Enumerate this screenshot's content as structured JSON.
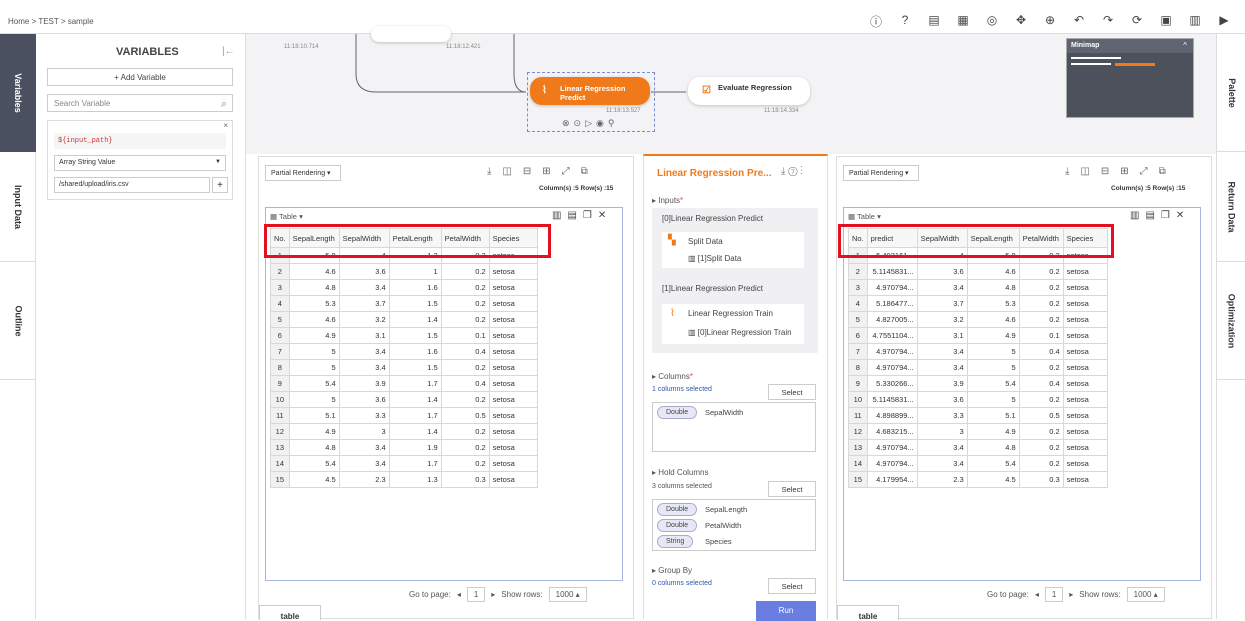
{
  "breadcrumb": "Home > TEST > sample",
  "toolbar_icons": [
    "info-icon",
    "help-icon",
    "clipboard-icon",
    "layout-icon",
    "info-circle-icon",
    "move-icon",
    "zoom-icon",
    "undo-icon",
    "redo-icon",
    "history-icon",
    "save-icon",
    "calendar-icon",
    "play-icon"
  ],
  "left_tabs": [
    "Variables",
    "Input Data",
    "Outline"
  ],
  "right_tabs": [
    "Palette",
    "Return Data",
    "Optimization"
  ],
  "variables": {
    "title": "VARIABLES",
    "add_label": "+ Add Variable",
    "search_placeholder": "Search Variable",
    "var_name": "${input_path}",
    "var_type": "Array String Value",
    "var_value": "/shared/upload/iris.csv"
  },
  "canvas": {
    "times": [
      "11:18:10.714",
      "11:18:12.421",
      "11:18:13.527",
      "11:18:14.334"
    ],
    "node_active": "Linear Regression Predict",
    "node_next": "Evaluate Regression",
    "minimap_title": "Minimap"
  },
  "left_table": {
    "rendering": "Partial Rendering",
    "info": "Column(s) :5  Row(s) :15",
    "label": "Table",
    "headers": [
      "No.",
      "SepalLength",
      "SepalWidth",
      "PetalLength",
      "PetalWidth",
      "Species"
    ],
    "rows": [
      [
        "1",
        "5.8",
        "4",
        "1.2",
        "0.2",
        "setosa"
      ],
      [
        "2",
        "4.6",
        "3.6",
        "1",
        "0.2",
        "setosa"
      ],
      [
        "3",
        "4.8",
        "3.4",
        "1.6",
        "0.2",
        "setosa"
      ],
      [
        "4",
        "5.3",
        "3.7",
        "1.5",
        "0.2",
        "setosa"
      ],
      [
        "5",
        "4.6",
        "3.2",
        "1.4",
        "0.2",
        "setosa"
      ],
      [
        "6",
        "4.9",
        "3.1",
        "1.5",
        "0.1",
        "setosa"
      ],
      [
        "7",
        "5",
        "3.4",
        "1.6",
        "0.4",
        "setosa"
      ],
      [
        "8",
        "5",
        "3.4",
        "1.5",
        "0.2",
        "setosa"
      ],
      [
        "9",
        "5.4",
        "3.9",
        "1.7",
        "0.4",
        "setosa"
      ],
      [
        "10",
        "5",
        "3.6",
        "1.4",
        "0.2",
        "setosa"
      ],
      [
        "11",
        "5.1",
        "3.3",
        "1.7",
        "0.5",
        "setosa"
      ],
      [
        "12",
        "4.9",
        "3",
        "1.4",
        "0.2",
        "setosa"
      ],
      [
        "13",
        "4.8",
        "3.4",
        "1.9",
        "0.2",
        "setosa"
      ],
      [
        "14",
        "5.4",
        "3.4",
        "1.7",
        "0.2",
        "setosa"
      ],
      [
        "15",
        "4.5",
        "2.3",
        "1.3",
        "0.3",
        "setosa"
      ]
    ],
    "goto_label": "Go to page:",
    "page": "1",
    "show_rows_label": "Show rows:",
    "show_rows": "1000",
    "tab": "table"
  },
  "right_table": {
    "rendering": "Partial Rendering",
    "info": "Column(s) :5  Row(s) :15",
    "label": "Table",
    "headers": [
      "No.",
      "predict",
      "SepalWidth",
      "SepalLength",
      "PetalWidth",
      "Species"
    ],
    "rows": [
      [
        "1",
        "5.402161...",
        "4",
        "5.8",
        "0.2",
        "setosa"
      ],
      [
        "2",
        "5.1145831...",
        "3.6",
        "4.6",
        "0.2",
        "setosa"
      ],
      [
        "3",
        "4.970794...",
        "3.4",
        "4.8",
        "0.2",
        "setosa"
      ],
      [
        "4",
        "5.186477...",
        "3.7",
        "5.3",
        "0.2",
        "setosa"
      ],
      [
        "5",
        "4.827005...",
        "3.2",
        "4.6",
        "0.2",
        "setosa"
      ],
      [
        "6",
        "4.7551104...",
        "3.1",
        "4.9",
        "0.1",
        "setosa"
      ],
      [
        "7",
        "4.970794...",
        "3.4",
        "5",
        "0.4",
        "setosa"
      ],
      [
        "8",
        "4.970794...",
        "3.4",
        "5",
        "0.2",
        "setosa"
      ],
      [
        "9",
        "5.330266...",
        "3.9",
        "5.4",
        "0.4",
        "setosa"
      ],
      [
        "10",
        "5.1145831...",
        "3.6",
        "5",
        "0.2",
        "setosa"
      ],
      [
        "11",
        "4.898899...",
        "3.3",
        "5.1",
        "0.5",
        "setosa"
      ],
      [
        "12",
        "4.683215...",
        "3",
        "4.9",
        "0.2",
        "setosa"
      ],
      [
        "13",
        "4.970794...",
        "3.4",
        "4.8",
        "0.2",
        "setosa"
      ],
      [
        "14",
        "4.970794...",
        "3.4",
        "5.4",
        "0.2",
        "setosa"
      ],
      [
        "15",
        "4.179954...",
        "2.3",
        "4.5",
        "0.3",
        "setosa"
      ]
    ],
    "goto_label": "Go to page:",
    "page": "1",
    "show_rows_label": "Show rows:",
    "show_rows": "1000",
    "tab": "table"
  },
  "mid": {
    "title": "Linear Regression Pre...",
    "inputs_label": "Inputs",
    "in0_label": "[0]Linear Regression Predict",
    "in0_node": "Split Data",
    "in0_sub": "[1]Split Data",
    "in1_label": "[1]Linear Regression Predict",
    "in1_node": "Linear Regression Train",
    "in1_sub": "[0]Linear Regression Train",
    "columns_label": "Columns",
    "columns_sel": "1 columns selected",
    "select": "Select",
    "columns": [
      {
        "type": "Double",
        "name": "SepalWidth"
      }
    ],
    "hold_label": "Hold Columns",
    "hold_sel": "3 columns selected",
    "hold": [
      {
        "type": "Double",
        "name": "SepalLength"
      },
      {
        "type": "Double",
        "name": "PetalWidth"
      },
      {
        "type": "String",
        "name": "Species"
      }
    ],
    "group_label": "Group By",
    "group_sel": "0 columns selected",
    "run": "Run"
  }
}
